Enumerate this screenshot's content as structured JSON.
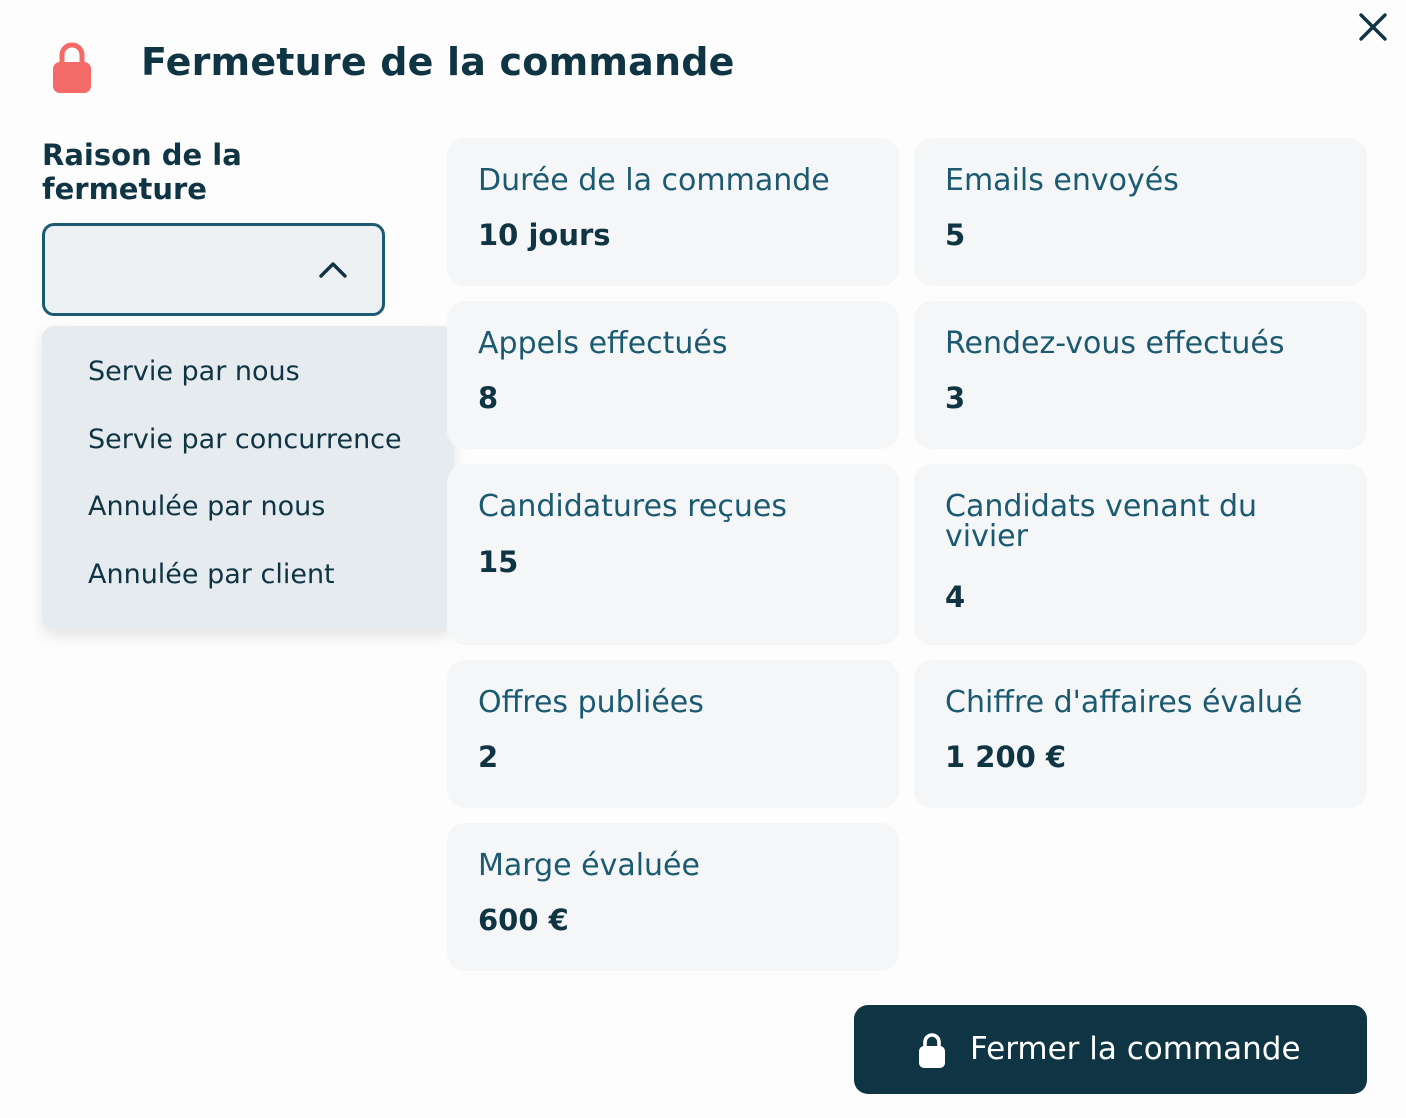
{
  "dialog": {
    "title": "Fermeture de la commande",
    "close_icon": "close-icon",
    "header_icon": "lock-icon",
    "accent_color": "#0f3443",
    "lock_color": "#f46a67"
  },
  "reason": {
    "label": "Raison de la fermeture",
    "selected_value": "",
    "options": [
      "Servie par nous",
      "Servie par concurrence",
      "Annulée par nous",
      "Annulée par client"
    ]
  },
  "stats": [
    {
      "label": "Durée de la commande",
      "value": "10 jours"
    },
    {
      "label": "Emails envoyés",
      "value": "5"
    },
    {
      "label": "Appels effectués",
      "value": "8"
    },
    {
      "label": "Rendez-vous effectués",
      "value": "3"
    },
    {
      "label": "Candidatures reçues",
      "value": "15"
    },
    {
      "label": "Candidats venant du vivier",
      "value": "4"
    },
    {
      "label": "Offres publiées",
      "value": "2"
    },
    {
      "label": "Chiffre d'affaires évalué",
      "value": "1 200 €"
    },
    {
      "label": "Marge évaluée",
      "value": "600 €"
    }
  ],
  "footer": {
    "close_order_label": "Fermer la commande",
    "close_order_icon": "lock-icon"
  }
}
